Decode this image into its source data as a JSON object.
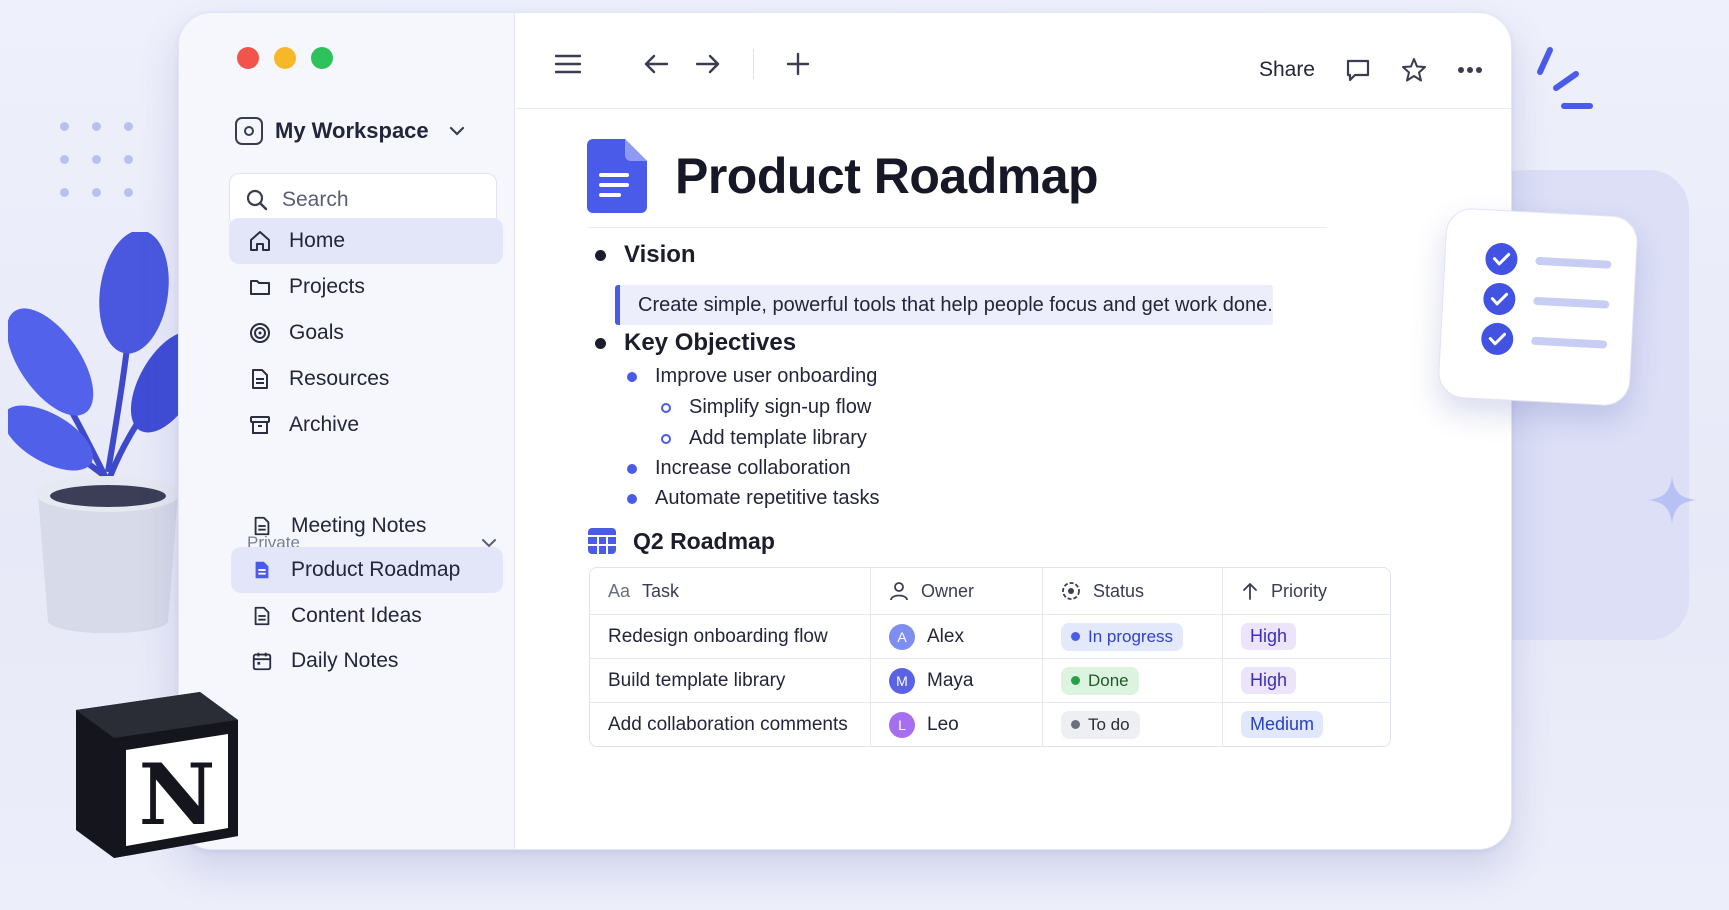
{
  "colors": {
    "accent": "#4a5bea",
    "sidebar_bg": "#f6f7fd",
    "active_item": "#e3e6f9"
  },
  "sidebar": {
    "workspace_name": "My Workspace",
    "search_placeholder": "Search",
    "nav": [
      {
        "label": "Home",
        "icon": "home-icon",
        "active": true
      },
      {
        "label": "Projects",
        "icon": "folder-icon"
      },
      {
        "label": "Goals",
        "icon": "target-icon"
      },
      {
        "label": "Resources",
        "icon": "document-icon"
      },
      {
        "label": "Archive",
        "icon": "archive-icon"
      }
    ],
    "private_label": "Private",
    "pages": [
      {
        "label": "Meeting Notes",
        "icon": "document-icon"
      },
      {
        "label": "Product Roadmap",
        "icon": "document-icon",
        "active": true
      },
      {
        "label": "Content Ideas",
        "icon": "document-icon"
      },
      {
        "label": "Daily Notes",
        "icon": "calendar-icon"
      }
    ]
  },
  "topbar": {
    "share_label": "Share"
  },
  "page": {
    "title": "Product Roadmap",
    "vision_heading": "Vision",
    "vision_text": "Create simple, powerful tools that help people focus and get work done.",
    "objectives_heading": "Key Objectives",
    "objectives": [
      {
        "text": "Improve user onboarding",
        "level": 1
      },
      {
        "text": "Simplify sign-up flow",
        "level": 2
      },
      {
        "text": "Add template library",
        "level": 2
      },
      {
        "text": "Increase collaboration",
        "level": 1
      },
      {
        "text": "Automate repetitive tasks",
        "level": 1
      }
    ],
    "database_title": "Q2 Roadmap",
    "table": {
      "headers": {
        "task_prefix": "Aa",
        "task": "Task",
        "owner": "Owner",
        "status": "Status",
        "priority": "Priority"
      },
      "rows": [
        {
          "task": "Redesign onboarding flow",
          "owner": "Alex",
          "owner_initial": "A",
          "avatar_color": "#7d8ef0",
          "status": "In progress",
          "status_kind": "progress",
          "priority": "High"
        },
        {
          "task": "Build template library",
          "owner": "Maya",
          "owner_initial": "M",
          "avatar_color": "#5a63e6",
          "status": "Done",
          "status_kind": "done",
          "priority": "High"
        },
        {
          "task": "Add collaboration comments",
          "owner": "Leo",
          "owner_initial": "L",
          "avatar_color": "#a56ff0",
          "status": "To do",
          "status_kind": "todo",
          "priority": "Medium"
        }
      ]
    }
  },
  "logo_letter": "N"
}
